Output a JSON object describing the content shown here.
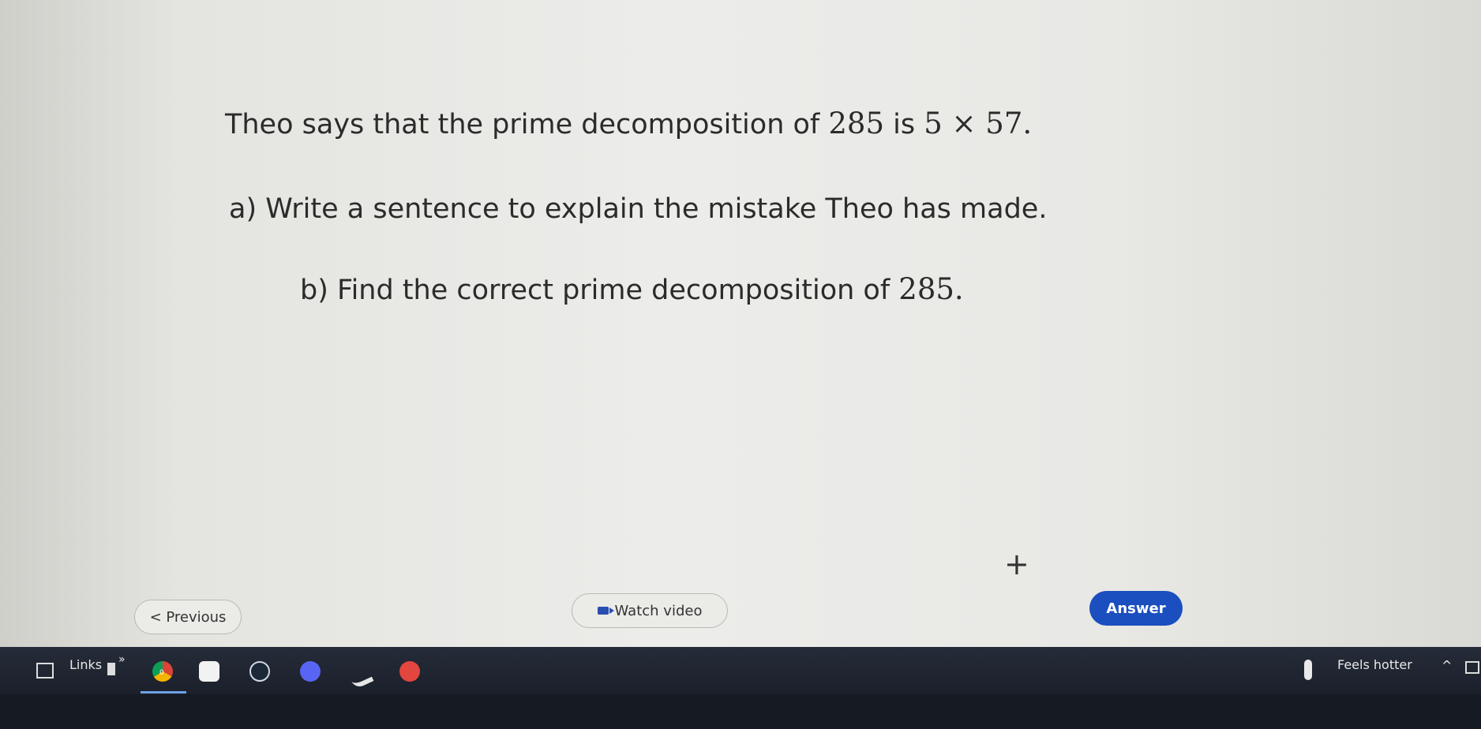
{
  "question": {
    "line1_text": "Theo says that the prime decomposition of ",
    "line1_number": "285",
    "line1_is": " is ",
    "line1_math": "5 × 57.",
    "line2": "a) Write a sentence to explain the mistake Theo has made.",
    "line3_text": "b) Find the correct prime decomposition of ",
    "line3_math": "285."
  },
  "plus_symbol": "+",
  "buttons": {
    "previous": "< Previous",
    "watch_video": "Watch video",
    "answer": "Answer"
  },
  "taskbar": {
    "links_label": "Links",
    "overflow": "»",
    "chrome_badge": "0",
    "weather_text": "Feels hotter",
    "caret": "^"
  },
  "colors": {
    "answer_button": "#1b4fbf",
    "taskbar": "#161a22"
  }
}
